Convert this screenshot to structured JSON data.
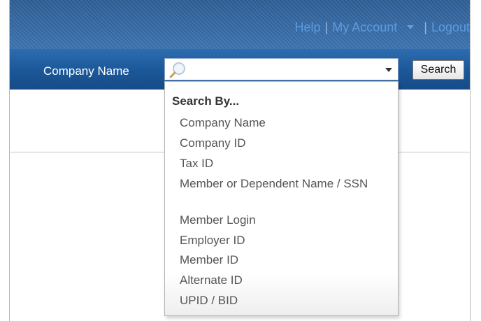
{
  "header": {
    "links": [
      {
        "label": "Help"
      },
      {
        "label": "My Account"
      },
      {
        "label": "Logout"
      }
    ],
    "separator": "|"
  },
  "search": {
    "label": "Company Name",
    "placeholder": "",
    "button_label": "Search",
    "dropdown": {
      "header": "Search By...",
      "items": [
        {
          "label": "Company Name"
        },
        {
          "label": "Company ID"
        },
        {
          "label": "Tax ID"
        },
        {
          "label": "Member or Dependent Name / SSN"
        },
        {
          "label": "Member Login"
        },
        {
          "label": "Employer ID"
        },
        {
          "label": "Member ID"
        },
        {
          "label": "Alternate ID"
        },
        {
          "label": "UPID / BID"
        }
      ]
    }
  },
  "colors": {
    "header_bg": "#3d74b0",
    "search_bar_bg": "#1b5798",
    "link_color": "#5d9ce0"
  },
  "icons": {
    "search": "magnifier-icon",
    "dropdown": "chevron-down-icon",
    "account_menu": "caret-down-icon"
  }
}
